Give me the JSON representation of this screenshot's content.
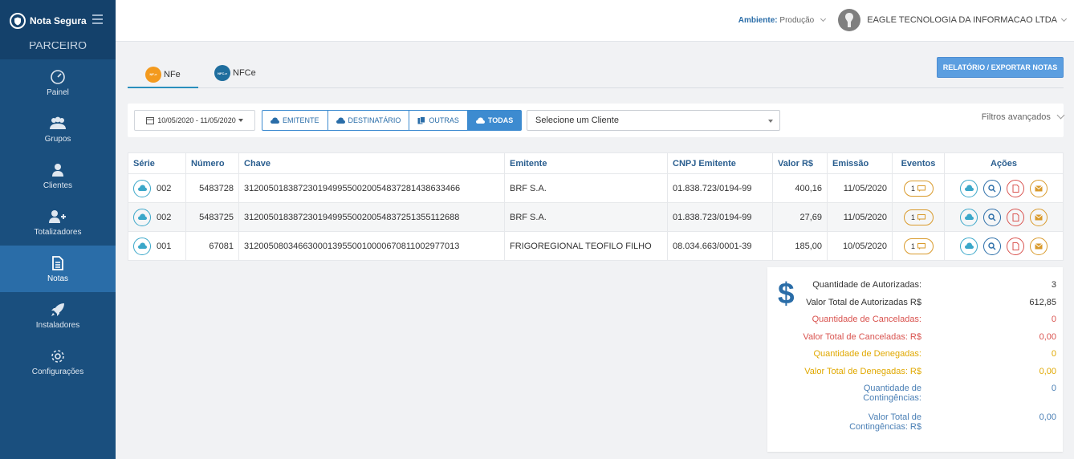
{
  "sidebar": {
    "brand": "Nota Segura",
    "partner": "PARCEIRO",
    "items": [
      {
        "label": "Painel",
        "icon": "dashboard-icon"
      },
      {
        "label": "Grupos",
        "icon": "users-icon"
      },
      {
        "label": "Clientes",
        "icon": "user-icon"
      },
      {
        "label": "Totalizadores",
        "icon": "user-plus-icon"
      },
      {
        "label": "Notas",
        "icon": "document-icon",
        "active": true
      },
      {
        "label": "Instaladores",
        "icon": "rocket-icon"
      },
      {
        "label": "Configurações",
        "icon": "gear-icon"
      }
    ]
  },
  "header": {
    "env_label": "Ambiente:",
    "env_value": "Produção",
    "company": "EAGLE TECNOLOGIA DA INFORMACAO LTDA"
  },
  "tabs": [
    {
      "label": "NFe",
      "badge": "NF-e",
      "color": "#f39a1e"
    },
    {
      "label": "NFCe",
      "badge": "NFC-e",
      "color": "#1f6e9e"
    }
  ],
  "report_button": "RELATÓRIO / EXPORTAR NOTAS",
  "filters": {
    "date_range": "10/05/2020 - 11/05/2020",
    "segments": [
      "EMITENTE",
      "DESTINATÁRIO",
      "OUTRAS",
      "TODAS"
    ],
    "client_placeholder": "Selecione um Cliente",
    "advanced": "Filtros avançados"
  },
  "table": {
    "headers": [
      "Série",
      "Número",
      "Chave",
      "Emitente",
      "CNPJ Emitente",
      "Valor R$",
      "Emissão",
      "Eventos",
      "Ações"
    ],
    "rows": [
      {
        "serie": "002",
        "numero": "5483728",
        "chave": "31200501838723019499550020054837281438633466",
        "emitente": "BRF S.A.",
        "cnpj": "01.838.723/0194-99",
        "valor": "400,16",
        "emissao": "11/05/2020",
        "eventos": "1"
      },
      {
        "serie": "002",
        "numero": "5483725",
        "chave": "31200501838723019499550020054837251355112688",
        "emitente": "BRF S.A.",
        "cnpj": "01.838.723/0194-99",
        "valor": "27,69",
        "emissao": "11/05/2020",
        "eventos": "1"
      },
      {
        "serie": "001",
        "numero": "67081",
        "chave": "31200508034663000139550010000670811002977013",
        "emitente": "FRIGOREGIONAL TEOFILO FILHO",
        "cnpj": "08.034.663/0001-39",
        "valor": "185,00",
        "emissao": "10/05/2020",
        "eventos": "1"
      }
    ]
  },
  "summary": {
    "symbol": "$",
    "qtd_aut_label": "Quantidade de Autorizadas:",
    "qtd_aut": "3",
    "val_aut_label": "Valor Total de Autorizadas R$",
    "val_aut": "612,85",
    "qtd_canc_label": "Quantidade de Canceladas:",
    "qtd_canc": "0",
    "val_canc_label": "Valor Total de Canceladas: R$",
    "val_canc": "0,00",
    "qtd_den_label": "Quantidade de Denegadas:",
    "qtd_den": "0",
    "val_den_label": "Valor Total de Denegadas: R$",
    "val_den": "0,00",
    "qtd_cont_label": "Quantidade de Contingências:",
    "qtd_cont": "0",
    "val_cont_label": "Valor Total de Contingências: R$",
    "val_cont": "0,00"
  },
  "colors": {
    "sidebar": "#1a4f7e",
    "accent": "#3d8bd0",
    "cancel": "#d9534f",
    "deny": "#e0a800",
    "contingency": "#4a7fb5"
  }
}
